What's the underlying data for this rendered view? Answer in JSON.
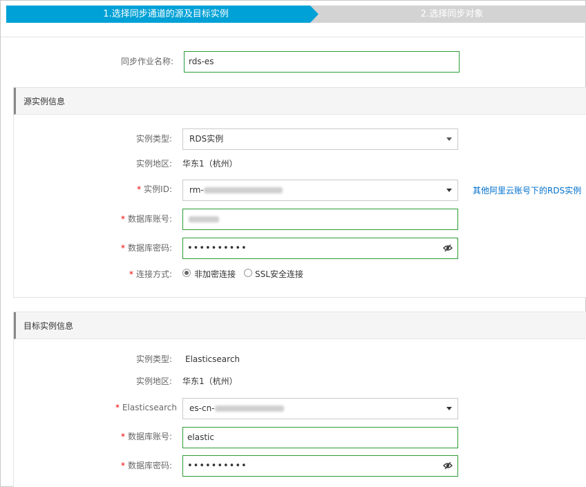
{
  "steps": {
    "step1": "1.选择同步通道的源及目标实例",
    "step2": "2.选择同步对象"
  },
  "job": {
    "label": "同步作业名称:",
    "value": "rds-es"
  },
  "source": {
    "title": "源实例信息",
    "type_label": "实例类型:",
    "type_value": "RDS实例",
    "region_label": "实例地区:",
    "region_value": "华东1（杭州）",
    "id_label": "实例ID:",
    "id_prefix": "rm-",
    "other_account_link": "其他阿里云账号下的RDS实例",
    "account_label": "数据库账号:",
    "password_label": "数据库密码:",
    "password_mask": "••••••••••",
    "connection_label": "连接方式:",
    "conn_option1": "非加密连接",
    "conn_option2": "SSL安全连接",
    "required_mark": "*"
  },
  "target": {
    "title": "目标实例信息",
    "type_label": "实例类型:",
    "type_value": "Elasticsearch",
    "region_label": "实例地区:",
    "region_value": "华东1（杭州）",
    "es_label": "Elasticsearch",
    "es_prefix": "es-cn-",
    "account_label": "数据库账号:",
    "account_value": "elastic",
    "password_label": "数据库密码:",
    "password_mask": "••••••••••",
    "required_mark": "*"
  },
  "colors": {
    "step_active": "#00a1d6",
    "step_inactive": "#d3d3d3",
    "input_border_valid": "#2b9b35",
    "link": "#0070cc",
    "required": "#e00000"
  },
  "icons": {
    "select_caret": "chevron-down-icon",
    "password_toggle": "eye-hidden-icon"
  }
}
